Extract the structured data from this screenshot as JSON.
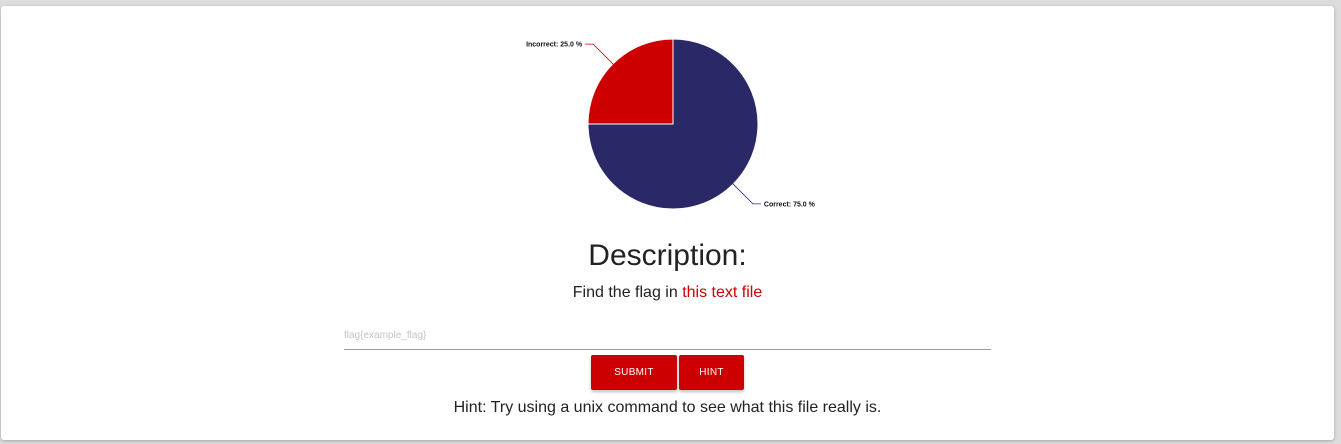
{
  "chart_data": {
    "type": "pie",
    "slices": [
      {
        "label": "Correct: 75.0 %",
        "value": 75.0,
        "color": "#2b2868"
      },
      {
        "label": "Incorrect: 25.0 %",
        "value": 25.0,
        "color": "#cc0000"
      }
    ]
  },
  "description": {
    "title": "Description:",
    "text_prefix": "Find the flag in ",
    "link_text": "this text file"
  },
  "form": {
    "placeholder": "flag{example_flag}",
    "submit_label": "SUBMIT",
    "hint_label": "HINT"
  },
  "hint": {
    "text": "Hint: Try using a unix command to see what this file really is."
  },
  "colors": {
    "accent": "#cc0000",
    "pie_correct": "#2b2868",
    "pie_incorrect": "#cc0000"
  }
}
